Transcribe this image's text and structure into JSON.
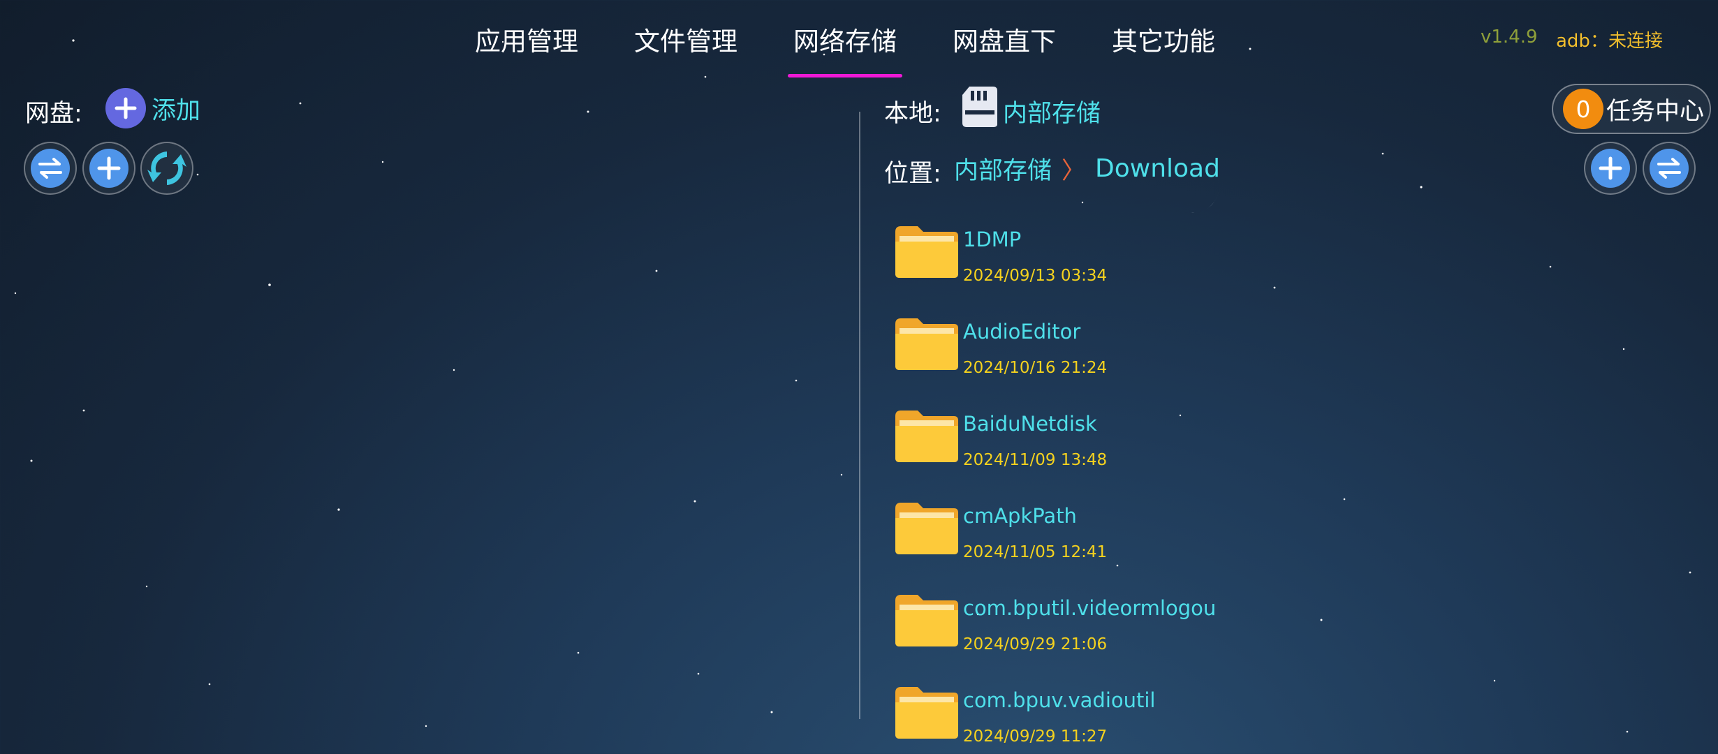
{
  "nav": {
    "tabs": [
      {
        "label": "应用管理"
      },
      {
        "label": "文件管理"
      },
      {
        "label": "网络存储",
        "active": true
      },
      {
        "label": "网盘直下"
      },
      {
        "label": "其它功能"
      }
    ],
    "version": "v1.4.9",
    "adb_status": "adb：未连接"
  },
  "left": {
    "cloud_label": "网盘:",
    "add_label": "添加",
    "icons": [
      "transfer-icon",
      "add-icon",
      "refresh-icon"
    ]
  },
  "right": {
    "local_label": "本地:",
    "storage_name": "内部存储",
    "location_label": "位置:",
    "breadcrumb": [
      "内部存储",
      "Download"
    ],
    "task_count": "0",
    "task_center_label": "任务中心",
    "files": [
      {
        "name": "1DMP",
        "date": "2024/09/13 03:34"
      },
      {
        "name": "AudioEditor",
        "date": "2024/10/16 21:24"
      },
      {
        "name": "BaiduNetdisk",
        "date": "2024/11/09 13:48"
      },
      {
        "name": "cmApkPath",
        "date": "2024/11/05 12:41"
      },
      {
        "name": "com.bputil.videormlogou",
        "date": "2024/09/29 21:06"
      },
      {
        "name": "com.bpuv.vadioutil",
        "date": "2024/09/29 11:27"
      }
    ]
  },
  "colors": {
    "accent": "#4fe0ea",
    "date": "#f5d21e",
    "active_tab_underline": "#ef19d6",
    "button_blue": "#4f95ea",
    "badge_orange": "#f28c0f"
  }
}
